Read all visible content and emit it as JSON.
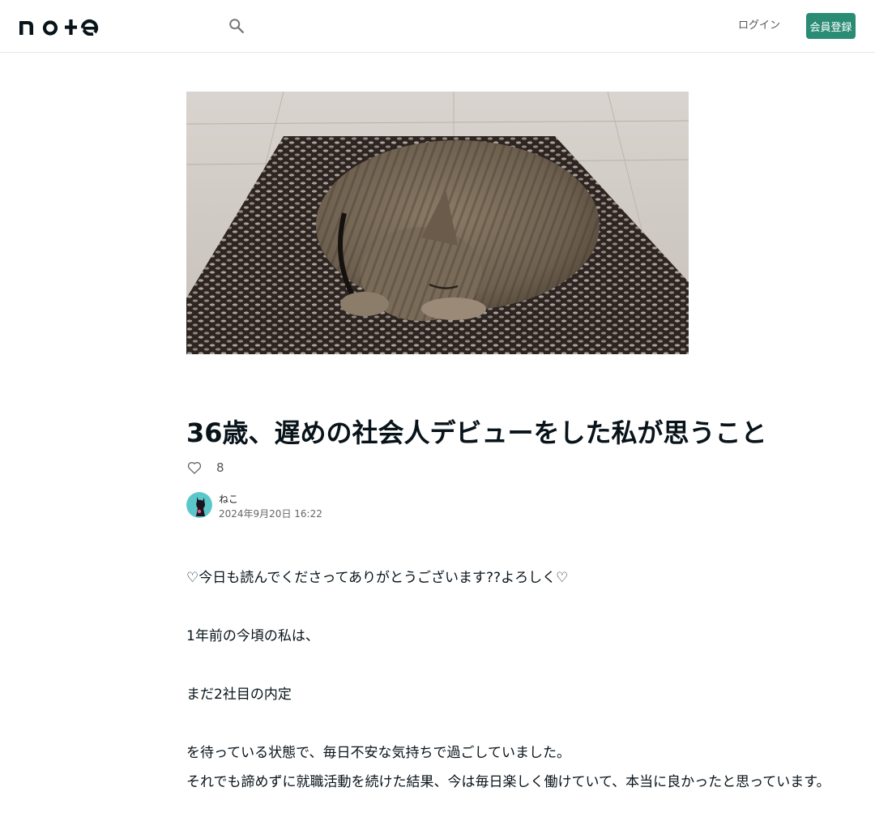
{
  "header": {
    "logo_text": "note",
    "login_label": "ログイン",
    "signup_label": "会員登録"
  },
  "article": {
    "title": "36歳、遅めの社会人デビューをした私が思うこと",
    "likes": "8",
    "author": {
      "name": "ねこ",
      "date": "2024年9月20日 16:22"
    },
    "paragraphs": [
      "♡今日も読んでくださってありがとうございます??よろしく♡",
      "1年前の今頃の私は、",
      "まだ2社目の内定",
      "を待っている状態で、毎日不安な気持ちで過ごしていました。",
      "それでも諦めずに就職活動を続けた結果、今は毎日楽しく働けていて、本当に良かったと思っています。"
    ]
  },
  "colors": {
    "accent": "#2a8c75",
    "text": "#08131a"
  }
}
